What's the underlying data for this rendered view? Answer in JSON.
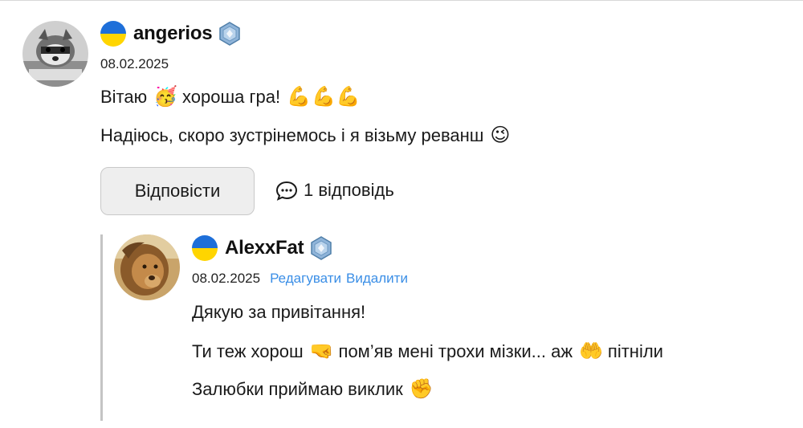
{
  "comment": {
    "author": "angerios",
    "date": "08.02.2025",
    "line1_a": "Вітаю",
    "line1_b": "хороша гра!",
    "line2": "Надіюсь, скоро зустрінемось і я візьму реванш",
    "emoji": {
      "party": "🥳",
      "muscle": "💪",
      "wink": "😉"
    },
    "reply_button": "Відповісти",
    "replies_count": "1 відповідь"
  },
  "reply": {
    "author": "AlexxFat",
    "date": "08.02.2025",
    "edit": "Редагувати",
    "delete": "Видалити",
    "line1": "Дякую за привітання!",
    "line2_a": "Ти теж хорош",
    "line2_b": "пом’яв мені трохи мізки... аж",
    "line2_c": "пітніли",
    "line3": "Залюбки приймаю виклик",
    "emoji": {
      "fist_left": "🤜",
      "hands": "🤲",
      "fist": "✊"
    }
  },
  "colors": {
    "link": "#3a8ee6",
    "flag_blue": "#1e6fd9",
    "flag_yellow": "#ffd500",
    "border": "#c9c9c9"
  },
  "icons": {
    "chat": "speech-bubble-icon",
    "flag": "ukraine-flag-icon",
    "badge": "crystal-badge-icon"
  }
}
